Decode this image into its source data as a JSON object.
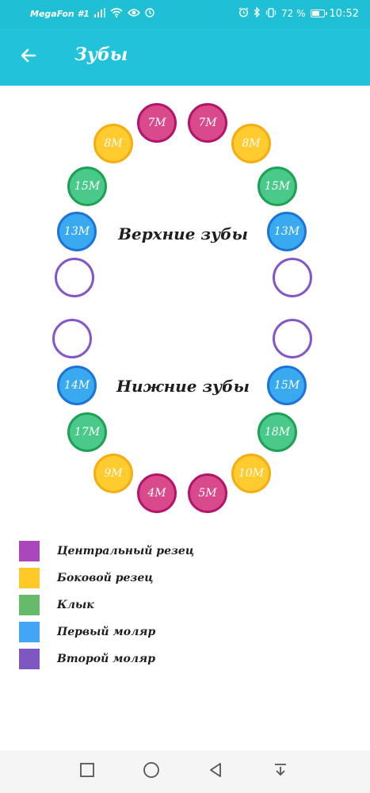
{
  "status_bar": {
    "carrier": "MegaFon #1",
    "battery_percent": "72 %",
    "battery_level": 0.72,
    "time": "10:52",
    "icons": [
      "signal-icon",
      "wifi-icon",
      "eye-icon",
      "clock-icon",
      "alarm-icon",
      "bluetooth-icon",
      "vibrate-icon",
      "battery-icon"
    ]
  },
  "app_bar": {
    "title": "Зубы",
    "back_icon": "arrow-left-icon"
  },
  "chart": {
    "upper_label": "Верхние зубы",
    "lower_label": "Нижние зубы",
    "upper_teeth": [
      {
        "id": "upper-left-second-molar",
        "type": "second",
        "label": ""
      },
      {
        "id": "upper-left-first-molar",
        "type": "first",
        "label": "13M"
      },
      {
        "id": "upper-left-canine",
        "type": "canine",
        "label": "15M"
      },
      {
        "id": "upper-left-lateral",
        "type": "lateral",
        "label": "8M"
      },
      {
        "id": "upper-left-central",
        "type": "central",
        "label": "7M"
      },
      {
        "id": "upper-right-central",
        "type": "central",
        "label": "7M"
      },
      {
        "id": "upper-right-lateral",
        "type": "lateral",
        "label": "8M"
      },
      {
        "id": "upper-right-canine",
        "type": "canine",
        "label": "15M"
      },
      {
        "id": "upper-right-first-molar",
        "type": "first",
        "label": "13M"
      },
      {
        "id": "upper-right-second-molar",
        "type": "second",
        "label": ""
      }
    ],
    "lower_teeth": [
      {
        "id": "lower-left-second-molar",
        "type": "second",
        "label": ""
      },
      {
        "id": "lower-left-first-molar",
        "type": "first",
        "label": "14M"
      },
      {
        "id": "lower-left-canine",
        "type": "canine",
        "label": "17M"
      },
      {
        "id": "lower-left-lateral",
        "type": "lateral",
        "label": "9M"
      },
      {
        "id": "lower-left-central",
        "type": "central",
        "label": "4M"
      },
      {
        "id": "lower-right-central",
        "type": "central",
        "label": "5M"
      },
      {
        "id": "lower-right-lateral",
        "type": "lateral",
        "label": "10M"
      },
      {
        "id": "lower-right-canine",
        "type": "canine",
        "label": "18M"
      },
      {
        "id": "lower-right-first-molar",
        "type": "first",
        "label": "15M"
      },
      {
        "id": "lower-right-second-molar",
        "type": "second",
        "label": ""
      }
    ]
  },
  "legend": [
    {
      "type": "central",
      "label": "Центральный резец",
      "color": "#ab47bc"
    },
    {
      "type": "lateral",
      "label": "Боковой резец",
      "color": "#ffca28"
    },
    {
      "type": "canine",
      "label": "Клык",
      "color": "#66bb6a"
    },
    {
      "type": "first",
      "label": "Первый моляр",
      "color": "#42a5f5"
    },
    {
      "type": "second",
      "label": "Второй моляр",
      "color": "#7e57c2"
    }
  ],
  "nav_bar": {
    "icons": [
      "square-icon",
      "circle-icon",
      "triangle-back-icon",
      "notification-down-icon"
    ]
  },
  "colors": {
    "app_bar": "#21c2da",
    "central": "#d94a8c",
    "lateral": "#ffcb2f",
    "canine": "#49c98a",
    "first_molar": "#3aaaf0",
    "second_molar_border": "#8457c9"
  }
}
